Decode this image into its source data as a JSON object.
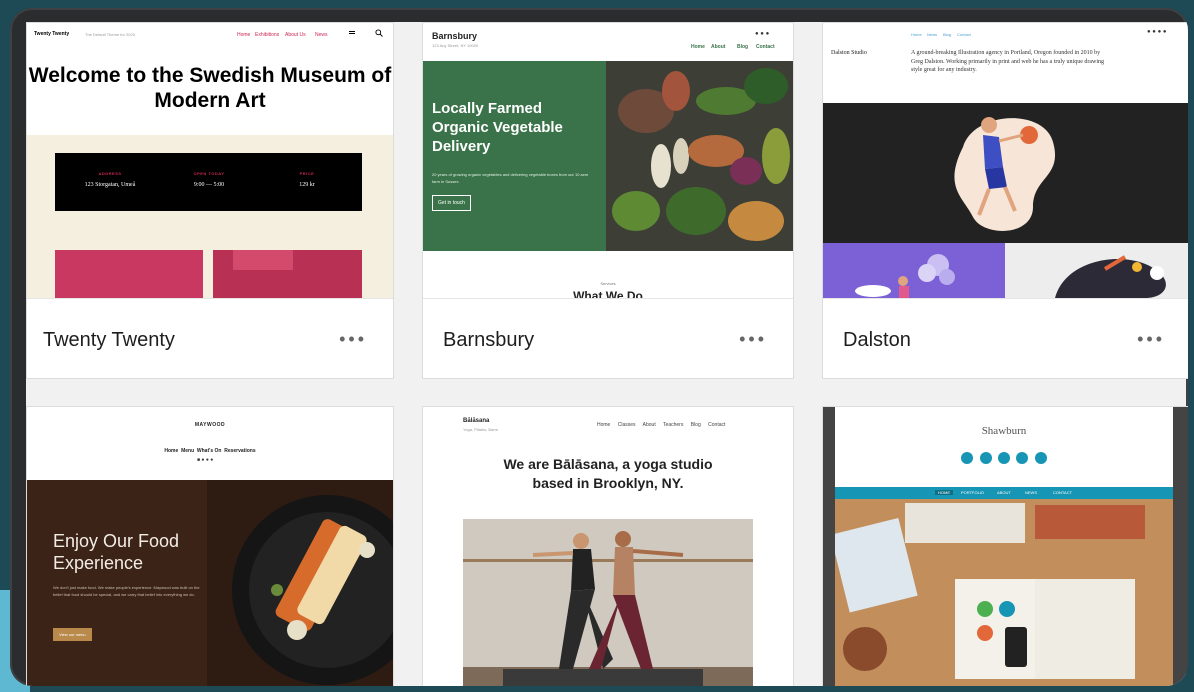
{
  "themes": [
    {
      "name": "Twenty Twenty",
      "preview": {
        "site_title": "Twenty Twenty",
        "tagline": "The Default Theme for 2020",
        "nav": [
          "Home",
          "Exhibitions",
          "About Us",
          "News"
        ],
        "heading": "Welcome to the Swedish Museum of Modern Art",
        "info": [
          {
            "label": "ADDRESS",
            "value": "123 Storgatan, Umeå"
          },
          {
            "label": "OPEN TODAY",
            "value": "9:00 — 5:00"
          },
          {
            "label": "PRICE",
            "value": "129 kr"
          }
        ]
      }
    },
    {
      "name": "Barnsbury",
      "preview": {
        "site_title": "Barnsbury",
        "subtitle": "123 Any Street, NY 10000",
        "nav": [
          "Home",
          "About",
          "Blog",
          "Contact"
        ],
        "heading": "Locally Farmed Organic Vegetable Delivery",
        "body": "20 years of growing organic vegetables and delivering vegetable boxes from our 10 acre farm in Sussex.",
        "button": "Get in touch",
        "section_label": "Services",
        "section_heading": "What We Do"
      }
    },
    {
      "name": "Dalston",
      "preview": {
        "site_title": "Dalston Studio",
        "nav": [
          "Home",
          "News",
          "Blog",
          "Contact"
        ],
        "intro": "A ground-breaking Illustration agency in Portland, Oregon founded in 2010 by Greg Dalston. Working primarily in print and web he has a truly unique drawing style great for any industry."
      }
    },
    {
      "name": "Maywood",
      "preview": {
        "site_title": "MAYWOOD",
        "nav": [
          "Home",
          "Menu",
          "What's On",
          "Reservations"
        ],
        "heading": "Enjoy Our Food Experience",
        "body": "We don't just make food. We make people's experience. Maywood was built on the belief that food should be special, and we carry that belief into everything we do.",
        "button": "View our menu"
      }
    },
    {
      "name": "Bālāsana",
      "preview": {
        "site_title": "Bālāsana",
        "subtitle": "Yoga, Pilates, Barre",
        "nav": [
          "Home",
          "Classes",
          "About",
          "Teachers",
          "Blog",
          "Contact"
        ],
        "heading": "We are Bālāsana, a yoga studio based in Brooklyn, NY."
      }
    },
    {
      "name": "Shawburn",
      "preview": {
        "site_title": "Shawburn",
        "nav": [
          "HOME",
          "PORTFOLIO",
          "ABOUT",
          "NEWS",
          "CONTACT"
        ]
      }
    }
  ],
  "more_label": "•••",
  "colors": {
    "page_bg": "#1d4a55",
    "accent_red": "#cd2653",
    "barnsbury_green": "#3a7349",
    "dalston_purple": "#7c61d6",
    "shawburn_blue": "#1795b4"
  }
}
